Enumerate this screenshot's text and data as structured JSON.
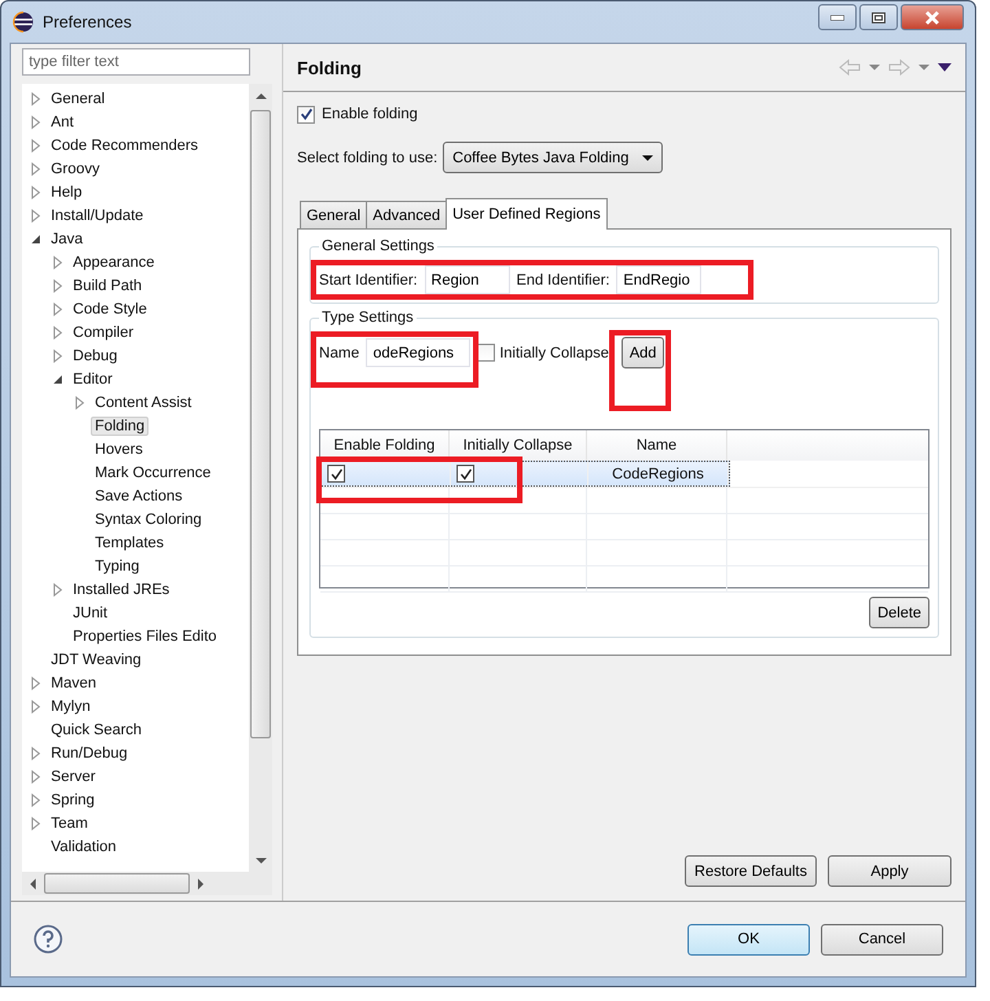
{
  "window": {
    "title": "Preferences"
  },
  "filter": {
    "placeholder": "type filter text"
  },
  "tree": [
    {
      "label": "General",
      "expandable": true,
      "expanded": false,
      "selected": false
    },
    {
      "label": "Ant",
      "expandable": true,
      "expanded": false,
      "selected": false
    },
    {
      "label": "Code Recommenders",
      "expandable": true,
      "expanded": false,
      "selected": false
    },
    {
      "label": "Groovy",
      "expandable": true,
      "expanded": false,
      "selected": false
    },
    {
      "label": "Help",
      "expandable": true,
      "expanded": false,
      "selected": false
    },
    {
      "label": "Install/Update",
      "expandable": true,
      "expanded": false,
      "selected": false
    },
    {
      "label": "Java",
      "expandable": true,
      "expanded": true,
      "selected": false,
      "children": [
        {
          "label": "Appearance",
          "expandable": true,
          "expanded": false,
          "selected": false
        },
        {
          "label": "Build Path",
          "expandable": true,
          "expanded": false,
          "selected": false
        },
        {
          "label": "Code Style",
          "expandable": true,
          "expanded": false,
          "selected": false
        },
        {
          "label": "Compiler",
          "expandable": true,
          "expanded": false,
          "selected": false
        },
        {
          "label": "Debug",
          "expandable": true,
          "expanded": false,
          "selected": false
        },
        {
          "label": "Editor",
          "expandable": true,
          "expanded": true,
          "selected": false,
          "children": [
            {
              "label": "Content Assist",
              "expandable": true,
              "expanded": false,
              "selected": false
            },
            {
              "label": "Folding",
              "selected": true
            },
            {
              "label": "Hovers",
              "selected": false
            },
            {
              "label": "Mark Occurrence",
              "selected": false
            },
            {
              "label": "Save Actions",
              "selected": false
            },
            {
              "label": "Syntax Coloring",
              "selected": false
            },
            {
              "label": "Templates",
              "selected": false
            },
            {
              "label": "Typing",
              "selected": false
            }
          ]
        },
        {
          "label": "Installed JREs",
          "expandable": true,
          "expanded": false,
          "selected": false
        },
        {
          "label": "JUnit",
          "selected": false
        },
        {
          "label": "Properties Files Edito",
          "selected": false
        }
      ]
    },
    {
      "label": "JDT Weaving",
      "selected": false
    },
    {
      "label": "Maven",
      "expandable": true,
      "expanded": false,
      "selected": false
    },
    {
      "label": "Mylyn",
      "expandable": true,
      "expanded": false,
      "selected": false
    },
    {
      "label": "Quick Search",
      "selected": false
    },
    {
      "label": "Run/Debug",
      "expandable": true,
      "expanded": false,
      "selected": false
    },
    {
      "label": "Server",
      "expandable": true,
      "expanded": false,
      "selected": false
    },
    {
      "label": "Spring",
      "expandable": true,
      "expanded": false,
      "selected": false
    },
    {
      "label": "Team",
      "expandable": true,
      "expanded": false,
      "selected": false
    },
    {
      "label": "Validation",
      "selected": false
    }
  ],
  "page": {
    "title": "Folding",
    "enable_folding": {
      "label": "Enable folding",
      "checked": true
    },
    "provider": {
      "label": "Select folding to use:",
      "value": "Coffee Bytes Java Folding"
    },
    "tabs": [
      {
        "label": "General",
        "selected": false
      },
      {
        "label": "Advanced",
        "selected": false
      },
      {
        "label": "User Defined Regions",
        "selected": true
      }
    ],
    "general_settings": {
      "title": "General Settings",
      "start_label": "Start Identifier:",
      "start_value": "Region",
      "end_label": "End Identifier:",
      "end_value": "EndRegio"
    },
    "type_settings": {
      "title": "Type Settings",
      "name_label": "Name",
      "name_value": "odeRegions",
      "collapse": {
        "label": "Initially Collapse",
        "checked": false
      },
      "add": "Add"
    },
    "table": {
      "columns": [
        "Enable Folding",
        "Initially Collapse",
        "Name"
      ],
      "rows": [
        {
          "enable_folding": true,
          "initially_collapse": true,
          "name": "CodeRegions",
          "selected": true
        }
      ]
    },
    "delete": "Delete"
  },
  "buttons": {
    "restore_defaults": "Restore Defaults",
    "apply": "Apply",
    "ok": "OK",
    "cancel": "Cancel"
  }
}
